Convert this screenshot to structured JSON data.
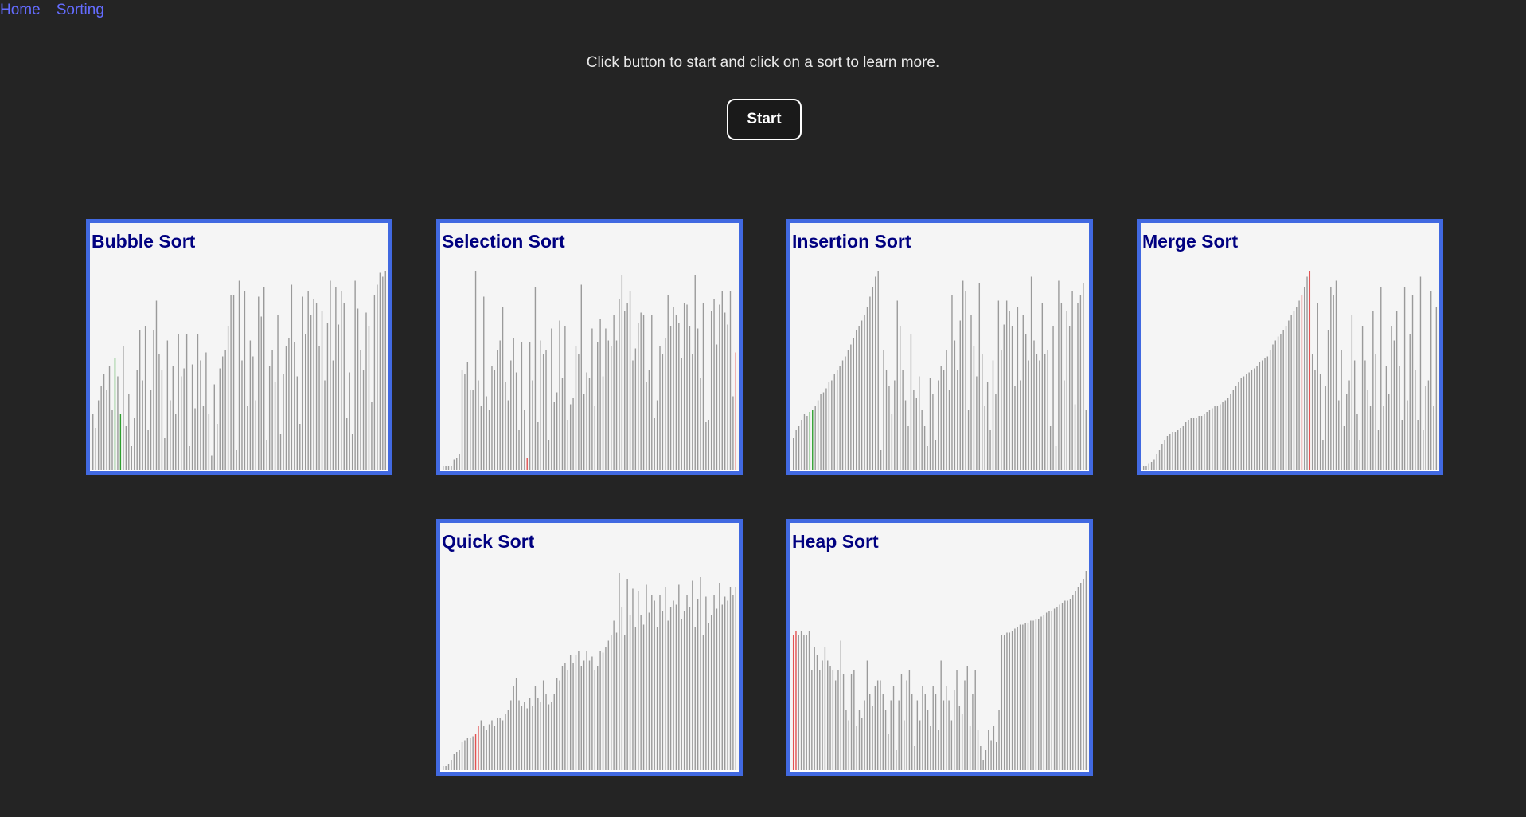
{
  "nav": {
    "home": "Home",
    "sorting": "Sorting"
  },
  "instructions": "Click button to start and click on a sort to learn more.",
  "start_label": "Start",
  "colors": {
    "background": "#242424",
    "nav_link": "#646cff",
    "card_border": "#4169e1",
    "card_background": "#f5f5f5",
    "card_title": "#000080",
    "bar_default": "#9a9a9a",
    "bar_compare": "#e35252",
    "bar_swap": "#2e9e2e"
  },
  "sorts": [
    {
      "title": "Bubble Sort",
      "values": [
        0.28,
        0.21,
        0.35,
        0.42,
        0.48,
        0.4,
        0.52,
        0.3,
        0.56,
        0.47,
        0.28,
        0.62,
        0.22,
        0.38,
        0.12,
        0.26,
        0.5,
        0.7,
        0.45,
        0.72,
        0.2,
        0.4,
        0.7,
        0.85,
        0.58,
        0.5,
        0.16,
        0.65,
        0.35,
        0.52,
        0.28,
        0.68,
        0.47,
        0.51,
        0.68,
        0.12,
        0.53,
        0.31,
        0.68,
        0.55,
        0.32,
        0.59,
        0.28,
        0.07,
        0.43,
        0.23,
        0.51,
        0.57,
        0.6,
        0.72,
        0.88,
        0.88,
        0.1,
        0.95,
        0.55,
        0.9,
        0.32,
        0.65,
        0.57,
        0.35,
        0.87,
        0.77,
        0.92,
        0.15,
        0.52,
        0.6,
        0.44,
        0.78,
        0.18,
        0.48,
        0.62,
        0.66,
        0.93,
        0.64,
        0.47,
        0.23,
        0.87,
        0.68,
        0.9,
        0.78,
        0.86,
        0.84,
        0.62,
        0.8,
        0.45,
        0.74,
        0.95,
        0.55,
        0.92,
        0.73,
        0.9,
        0.84,
        0.26,
        0.49,
        0.18,
        0.95,
        0.81,
        0.6,
        0.5,
        0.79,
        0.72,
        0.34,
        0.88,
        0.93,
        0.99,
        0.97,
        1.0
      ],
      "compare": [],
      "swap": [
        8,
        10
      ]
    },
    {
      "title": "Selection Sort",
      "values": [
        0.02,
        0.02,
        0.02,
        0.02,
        0.05,
        0.06,
        0.08,
        0.5,
        0.48,
        0.54,
        0.4,
        0.4,
        1.0,
        0.45,
        0.32,
        0.87,
        0.37,
        0.3,
        0.52,
        0.5,
        0.6,
        0.65,
        0.82,
        0.44,
        0.35,
        0.55,
        0.66,
        0.49,
        0.2,
        0.64,
        0.3,
        0.06,
        0.64,
        0.45,
        0.92,
        0.24,
        0.65,
        0.58,
        0.6,
        0.15,
        0.71,
        0.34,
        0.39,
        0.75,
        0.46,
        0.72,
        0.25,
        0.33,
        0.36,
        0.62,
        0.58,
        0.93,
        0.38,
        0.49,
        0.46,
        0.71,
        0.32,
        0.64,
        0.76,
        0.47,
        0.71,
        0.65,
        0.62,
        0.78,
        0.65,
        0.86,
        0.98,
        0.8,
        0.84,
        0.9,
        0.55,
        0.61,
        0.74,
        0.79,
        0.78,
        0.44,
        0.5,
        0.78,
        0.26,
        0.35,
        0.62,
        0.58,
        0.66,
        0.88,
        0.72,
        0.82,
        0.78,
        0.74,
        0.56,
        0.84,
        0.83,
        0.72,
        0.58,
        0.98,
        0.71,
        0.46,
        0.84,
        0.24,
        0.25,
        0.8,
        0.86,
        0.63,
        0.83,
        0.9,
        0.79,
        0.73,
        0.9,
        0.37,
        0.59
      ],
      "compare": [
        31,
        108
      ],
      "swap": []
    },
    {
      "title": "Insertion Sort",
      "values": [
        0.16,
        0.2,
        0.22,
        0.25,
        0.28,
        0.27,
        0.29,
        0.3,
        0.32,
        0.35,
        0.38,
        0.39,
        0.41,
        0.44,
        0.45,
        0.48,
        0.5,
        0.52,
        0.55,
        0.57,
        0.6,
        0.63,
        0.66,
        0.7,
        0.72,
        0.75,
        0.78,
        0.82,
        0.87,
        0.92,
        0.97,
        1.0,
        0.1,
        0.6,
        0.5,
        0.42,
        0.28,
        0.45,
        0.85,
        0.72,
        0.5,
        0.35,
        0.22,
        0.68,
        0.4,
        0.36,
        0.47,
        0.3,
        0.22,
        0.12,
        0.46,
        0.38,
        0.15,
        0.45,
        0.52,
        0.5,
        0.6,
        0.4,
        0.88,
        0.65,
        0.5,
        0.75,
        0.95,
        0.9,
        0.3,
        0.78,
        0.62,
        0.47,
        0.94,
        0.58,
        0.32,
        0.44,
        0.2,
        0.55,
        0.38,
        0.85,
        0.6,
        0.73,
        0.85,
        0.8,
        0.72,
        0.42,
        0.82,
        0.45,
        0.78,
        0.68,
        0.55,
        0.97,
        0.65,
        0.58,
        0.55,
        0.84,
        0.58,
        0.6,
        0.22,
        0.72,
        0.12,
        0.95,
        0.84,
        0.45,
        0.8,
        0.72,
        0.9,
        0.33,
        0.84,
        0.88,
        0.94,
        0.3
      ],
      "compare": [],
      "swap": [
        6,
        7
      ]
    },
    {
      "title": "Merge Sort",
      "values": [
        0.02,
        0.02,
        0.03,
        0.04,
        0.05,
        0.08,
        0.1,
        0.13,
        0.15,
        0.17,
        0.18,
        0.19,
        0.19,
        0.2,
        0.21,
        0.22,
        0.24,
        0.25,
        0.26,
        0.26,
        0.26,
        0.27,
        0.27,
        0.28,
        0.29,
        0.3,
        0.31,
        0.32,
        0.32,
        0.33,
        0.34,
        0.35,
        0.36,
        0.38,
        0.4,
        0.42,
        0.44,
        0.46,
        0.47,
        0.48,
        0.49,
        0.5,
        0.51,
        0.52,
        0.54,
        0.55,
        0.56,
        0.57,
        0.6,
        0.63,
        0.65,
        0.67,
        0.68,
        0.7,
        0.72,
        0.75,
        0.78,
        0.8,
        0.82,
        0.85,
        0.88,
        0.92,
        0.97,
        1.0,
        0.58,
        0.5,
        0.84,
        0.48,
        0.15,
        0.42,
        0.7,
        0.92,
        0.88,
        0.95,
        0.35,
        0.6,
        0.22,
        0.38,
        0.45,
        0.78,
        0.55,
        0.28,
        0.15,
        0.72,
        0.55,
        0.4,
        0.32,
        0.8,
        0.58,
        0.2,
        0.92,
        0.32,
        0.52,
        0.38,
        0.72,
        0.65,
        0.8,
        0.52,
        0.25,
        0.92,
        0.35,
        0.68,
        0.88,
        0.5,
        0.25,
        0.97,
        0.2,
        0.42,
        0.45,
        0.9,
        0.32,
        0.82
      ],
      "compare": [
        60,
        63
      ],
      "swap": []
    },
    {
      "title": "Quick Sort",
      "values": [
        0.02,
        0.02,
        0.03,
        0.05,
        0.08,
        0.09,
        0.1,
        0.14,
        0.15,
        0.16,
        0.16,
        0.17,
        0.18,
        0.22,
        0.25,
        0.22,
        0.2,
        0.23,
        0.25,
        0.22,
        0.26,
        0.26,
        0.25,
        0.28,
        0.3,
        0.35,
        0.42,
        0.46,
        0.35,
        0.32,
        0.34,
        0.31,
        0.36,
        0.32,
        0.42,
        0.36,
        0.34,
        0.45,
        0.38,
        0.33,
        0.34,
        0.38,
        0.46,
        0.45,
        0.52,
        0.54,
        0.5,
        0.58,
        0.54,
        0.58,
        0.6,
        0.52,
        0.55,
        0.6,
        0.55,
        0.57,
        0.5,
        0.52,
        0.6,
        0.59,
        0.62,
        0.65,
        0.68,
        0.75,
        0.69,
        0.99,
        0.82,
        0.68,
        0.96,
        0.78,
        0.91,
        0.72,
        0.9,
        0.78,
        0.73,
        0.93,
        0.79,
        0.88,
        0.85,
        0.72,
        0.88,
        0.8,
        0.92,
        0.75,
        0.82,
        0.85,
        0.83,
        0.93,
        0.76,
        0.8,
        0.88,
        0.82,
        0.95,
        0.72,
        0.86,
        0.97,
        0.68,
        0.87,
        0.74,
        0.78,
        0.88,
        0.81,
        0.94,
        0.83,
        0.87,
        0.85,
        0.92,
        0.88,
        0.92
      ],
      "compare": [
        12,
        13
      ],
      "swap": []
    },
    {
      "title": "Heap Sort",
      "values": [
        0.68,
        0.7,
        0.68,
        0.7,
        0.68,
        0.68,
        0.7,
        0.5,
        0.62,
        0.58,
        0.5,
        0.55,
        0.62,
        0.55,
        0.52,
        0.5,
        0.45,
        0.5,
        0.65,
        0.48,
        0.3,
        0.25,
        0.48,
        0.5,
        0.22,
        0.3,
        0.26,
        0.35,
        0.55,
        0.38,
        0.32,
        0.42,
        0.45,
        0.45,
        0.38,
        0.3,
        0.18,
        0.35,
        0.42,
        0.1,
        0.35,
        0.48,
        0.25,
        0.45,
        0.5,
        0.38,
        0.12,
        0.35,
        0.25,
        0.42,
        0.38,
        0.3,
        0.22,
        0.42,
        0.38,
        0.2,
        0.55,
        0.35,
        0.42,
        0.35,
        0.25,
        0.4,
        0.5,
        0.32,
        0.28,
        0.45,
        0.52,
        0.22,
        0.38,
        0.5,
        0.2,
        0.12,
        0.05,
        0.1,
        0.2,
        0.15,
        0.22,
        0.14,
        0.3,
        0.68,
        0.68,
        0.69,
        0.69,
        0.7,
        0.71,
        0.72,
        0.73,
        0.73,
        0.74,
        0.74,
        0.75,
        0.75,
        0.76,
        0.76,
        0.77,
        0.78,
        0.79,
        0.8,
        0.8,
        0.81,
        0.82,
        0.83,
        0.84,
        0.85,
        0.85,
        0.86,
        0.88,
        0.9,
        0.92,
        0.94,
        0.96,
        1.0
      ],
      "compare": [
        0,
        1
      ],
      "swap": []
    }
  ]
}
